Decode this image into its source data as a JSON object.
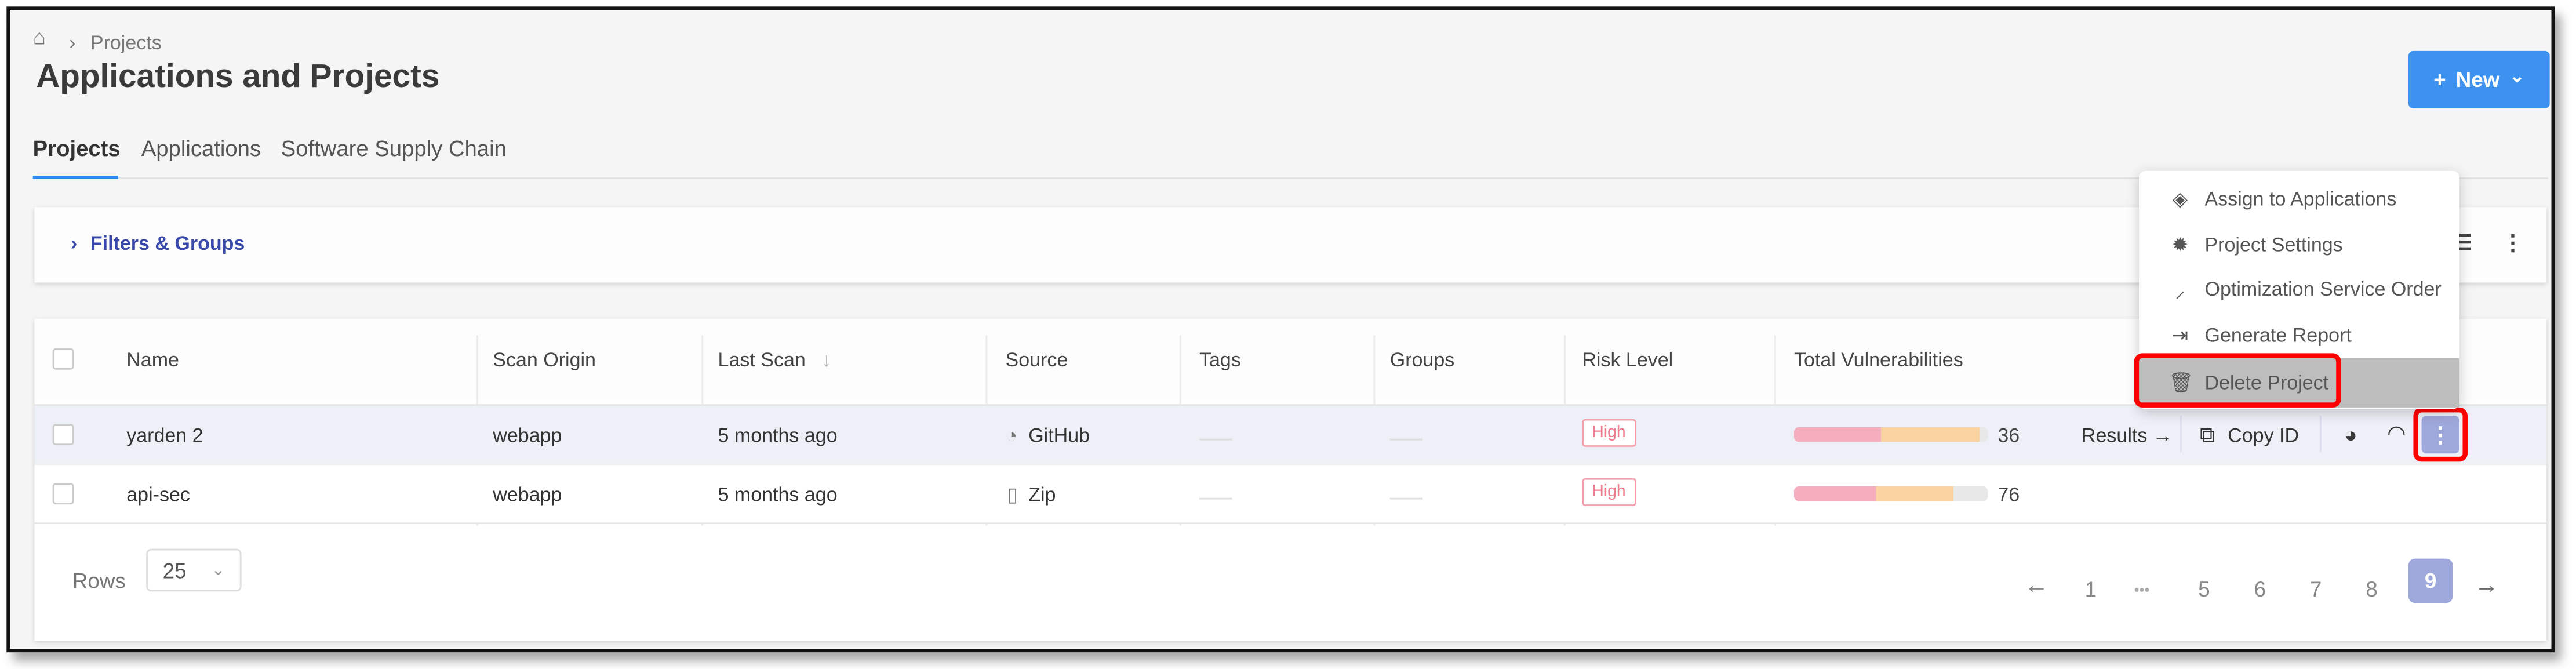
{
  "breadcrumb": {
    "home_icon": "home-icon",
    "separator": "›",
    "current": "Projects"
  },
  "header": {
    "title": "Applications and Projects",
    "new_button": {
      "plus": "+",
      "label": "New",
      "chevron": "⌄"
    }
  },
  "tabs": [
    {
      "label": "Projects",
      "active": true
    },
    {
      "label": "Applications"
    },
    {
      "label": "Software Supply Chain"
    }
  ],
  "filters": {
    "label": "Filters & Groups"
  },
  "table": {
    "columns": [
      "Name",
      "Scan Origin",
      "Last Scan",
      "Source",
      "Tags",
      "Groups",
      "Risk Level",
      "Total Vulnerabilities"
    ],
    "sort_indicator": "↓",
    "rows": [
      {
        "name": "yarden 2",
        "scan_origin": "webapp",
        "last_scan": "5 months ago",
        "source": "GitHub",
        "source_icon": "github-icon",
        "risk": "High",
        "total": "36",
        "bar": {
          "high_pct": 45,
          "medium_pct": 51
        }
      },
      {
        "name": "api-sec",
        "scan_origin": "webapp",
        "last_scan": "5 months ago",
        "source": "Zip",
        "source_icon": "zip-icon",
        "risk": "High",
        "total": "76",
        "bar": {
          "high_pct": 42,
          "medium_pct": 40
        }
      }
    ],
    "row_actions": {
      "results": "Results →",
      "copy_id": "Copy ID"
    }
  },
  "menu": {
    "items": [
      {
        "label": "Assign to Applications",
        "icon": "layers-icon"
      },
      {
        "label": "Project Settings",
        "icon": "gear-icon"
      },
      {
        "label": "Optimization Service Order",
        "icon": "magic-wand-icon"
      },
      {
        "label": "Generate Report",
        "icon": "export-icon"
      },
      {
        "label": "Delete Project",
        "icon": "trash-icon",
        "highlighted": true
      }
    ]
  },
  "pagination": {
    "rows_label": "Rows",
    "rows_value": "25",
    "pages": [
      "1",
      "•••",
      "5",
      "6",
      "7",
      "8",
      "9"
    ],
    "current": "9",
    "prev": "←",
    "next": "→"
  },
  "colors": {
    "primary": "#3d91ef",
    "link": "#3949ab",
    "active_page": "#9fa8da",
    "highlight": "#ff0000",
    "high_risk": "#ef7b8e"
  }
}
